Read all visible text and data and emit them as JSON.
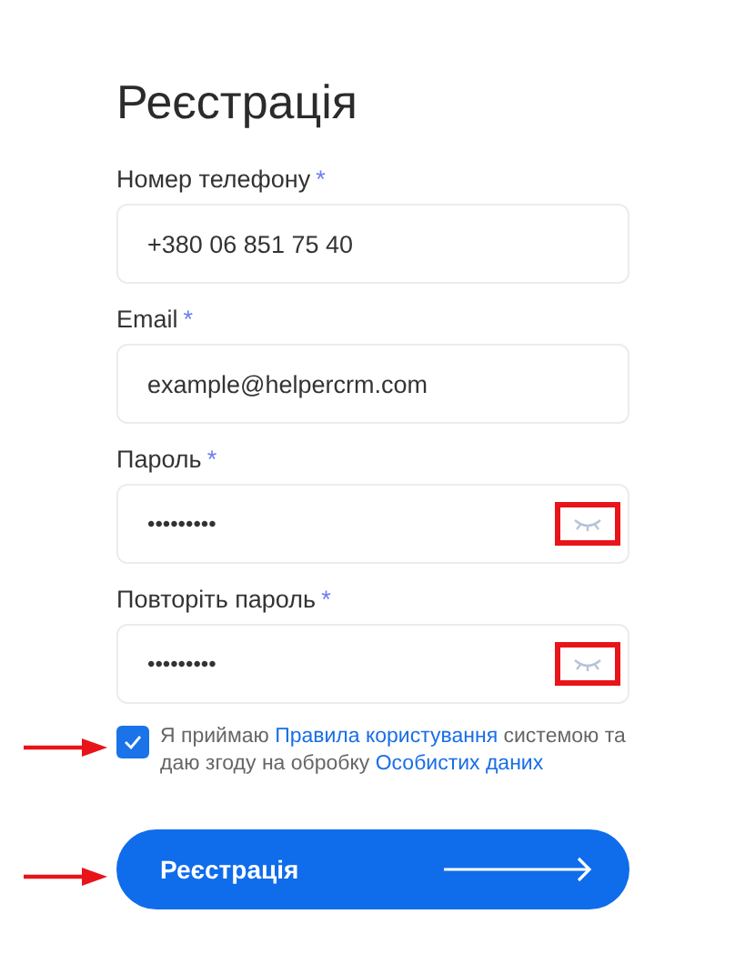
{
  "title": "Реєстрація",
  "fields": [
    {
      "label": "Номер телефону",
      "required_mark": "*",
      "value": "+380 06 851 75 40",
      "kind": "text"
    },
    {
      "label": "Email",
      "required_mark": "*",
      "value": "example@helpercrm.com",
      "kind": "text"
    },
    {
      "label": "Пароль",
      "required_mark": "*",
      "value": "•••••••••",
      "kind": "password"
    },
    {
      "label": "Повторіть пароль",
      "required_mark": "*",
      "value": "•••••••••",
      "kind": "password"
    }
  ],
  "consent": {
    "checked": true,
    "parts": [
      {
        "kind": "text",
        "text": "Я приймаю "
      },
      {
        "kind": "link",
        "text": "Правила користування"
      },
      {
        "kind": "text",
        "text": " системою та даю згоду на обробку "
      },
      {
        "kind": "link",
        "text": "Особистих даних"
      }
    ]
  },
  "submit": {
    "label": "Реєстрація"
  }
}
